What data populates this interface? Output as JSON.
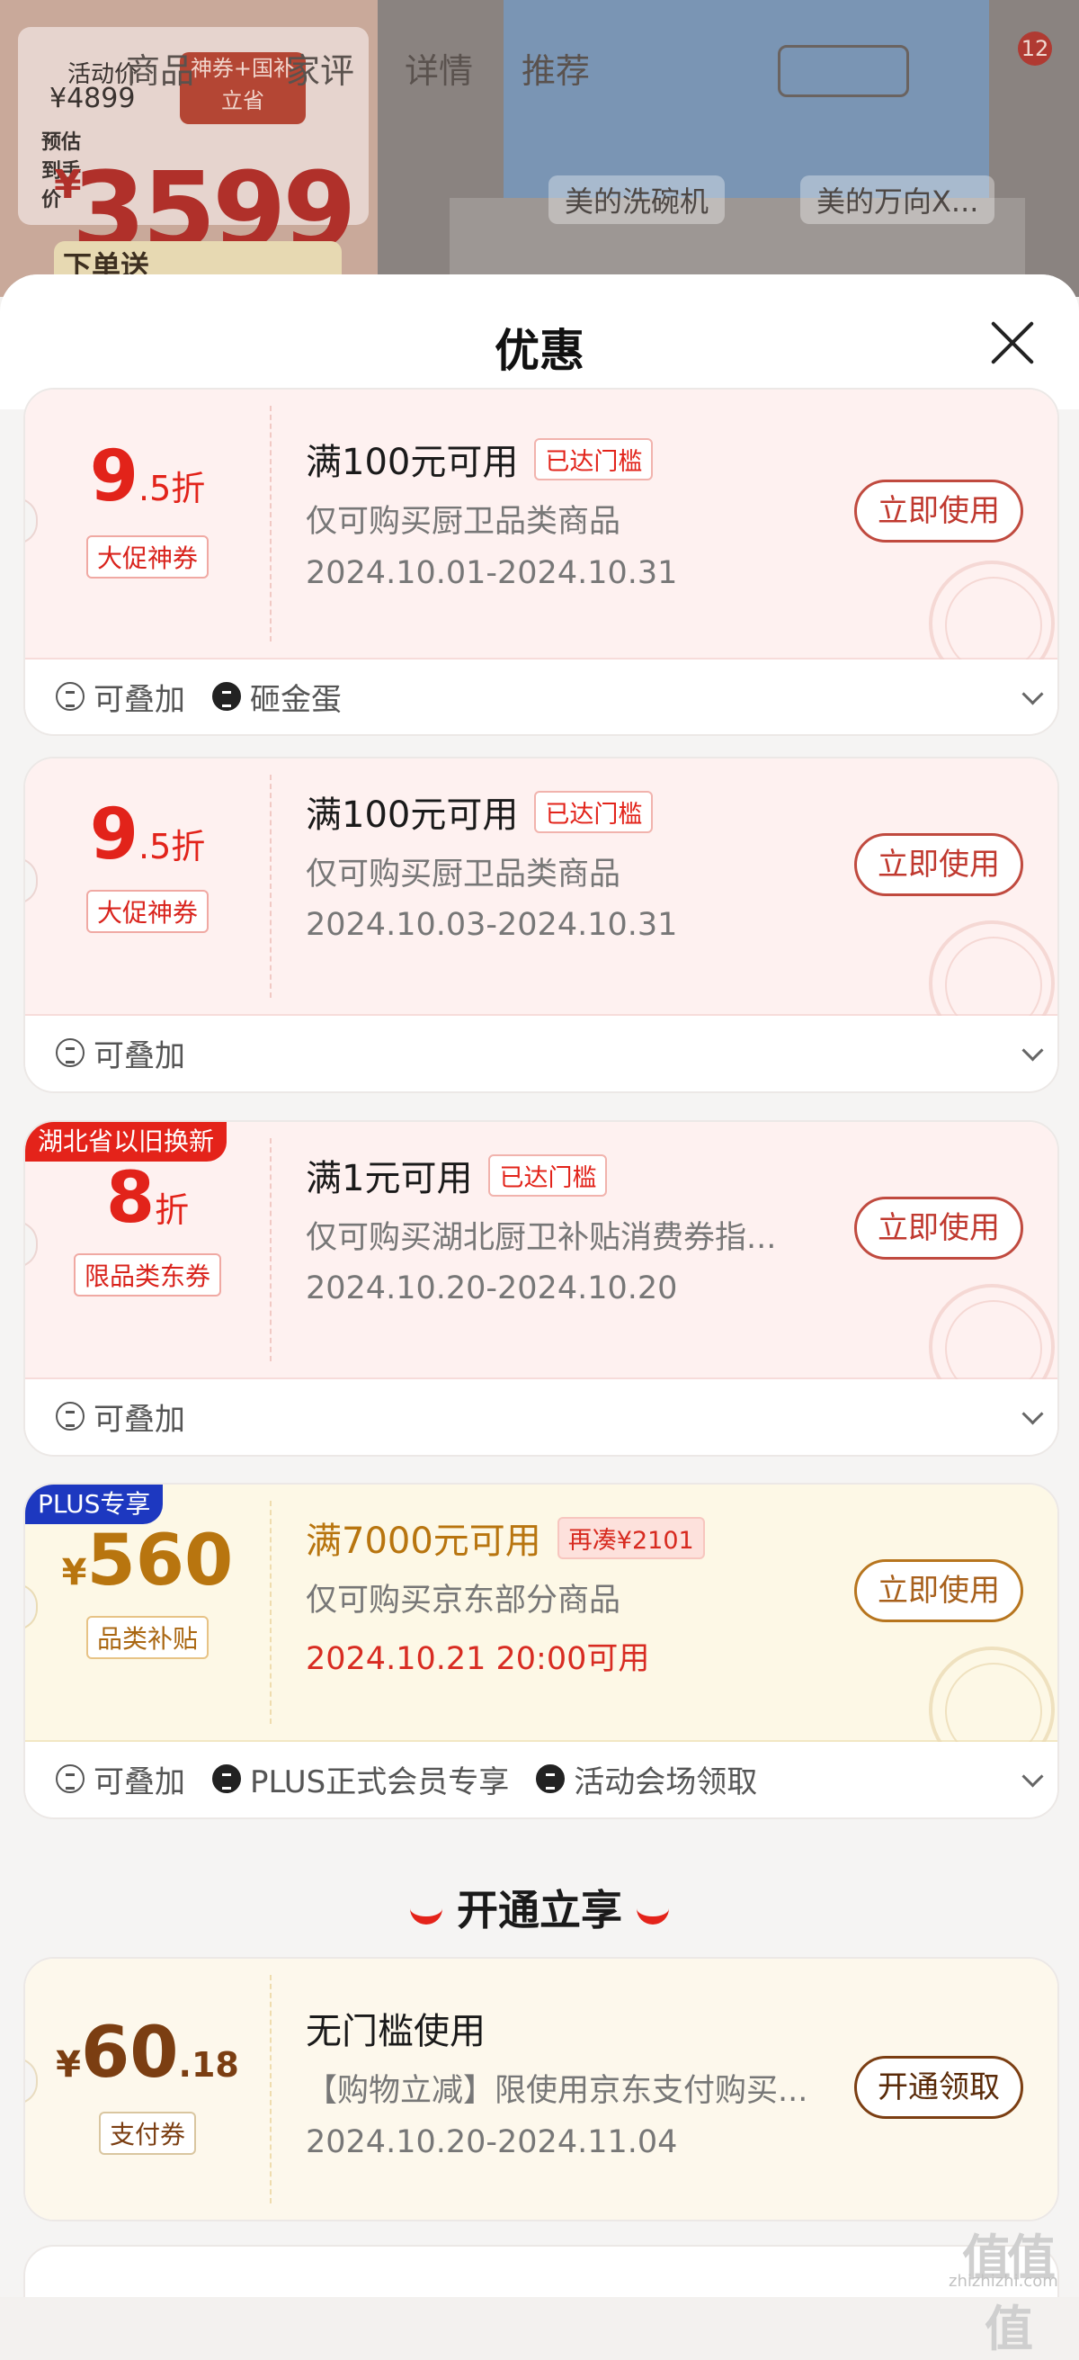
{
  "background": {
    "tabs": [
      "商品",
      "评价",
      "家评",
      "详情",
      "推荐"
    ],
    "activity_price_label": "活动价",
    "activity_price": "¥4899",
    "promo_tag": "神券+国补 立省",
    "estimated_label": "预估 到手价",
    "final_price": "3599",
    "currency": "¥",
    "chips": [
      "美的洗碗机",
      "美的万向X..."
    ],
    "order_gift": "下单送",
    "cart_badge": "12"
  },
  "sheet": {
    "title": "优惠"
  },
  "coupons": [
    {
      "value_main": "9",
      "value_sub": ".5折",
      "type": "大促神券",
      "condition": "满100元可用",
      "condition_badge": "已达门槛",
      "description": "仅可购买厨卫品类商品",
      "date": "2024.10.01-2024.10.31",
      "button": "立即使用",
      "tags": [
        "可叠加",
        "砸金蛋"
      ]
    },
    {
      "value_main": "9",
      "value_sub": ".5折",
      "type": "大促神券",
      "condition": "满100元可用",
      "condition_badge": "已达门槛",
      "description": "仅可购买厨卫品类商品",
      "date": "2024.10.03-2024.10.31",
      "button": "立即使用",
      "tags": [
        "可叠加"
      ]
    },
    {
      "ribbon": "湖北省以旧换新",
      "value_main": "8",
      "value_sub": "折",
      "type": "限品类东券",
      "condition": "满1元可用",
      "condition_badge": "已达门槛",
      "description": "仅可购买湖北厨卫补贴消费券指...",
      "date": "2024.10.20-2024.10.20",
      "button": "立即使用",
      "tags": [
        "可叠加"
      ]
    },
    {
      "ribbon": "PLUS专享",
      "currency": "¥",
      "value_main": "560",
      "type": "品类补贴",
      "condition": "满7000元可用",
      "condition_badge": "再凑¥2101",
      "description": "仅可购买京东部分商品",
      "date": "2024.10.21 20:00可用",
      "button": "立即使用",
      "tags": [
        "可叠加",
        "PLUS正式会员专享",
        "活动会场领取"
      ]
    }
  ],
  "section": {
    "title": "开通立享"
  },
  "payment_coupon": {
    "currency": "¥",
    "value_main": "60",
    "value_sub": ".18",
    "type": "支付券",
    "condition": "无门槛使用",
    "description": "【购物立减】限使用京东支付购买...",
    "date": "2024.10.20-2024.11.04",
    "button": "开通领取"
  },
  "watermark": {
    "text": "值值值",
    "sub": "zhizhizhi.com"
  }
}
